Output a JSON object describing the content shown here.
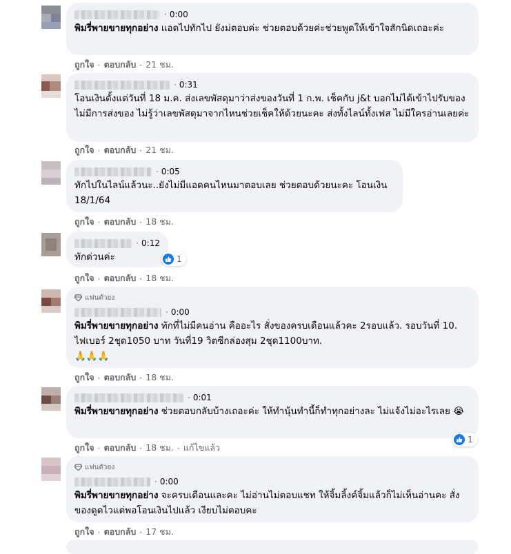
{
  "common": {
    "like": "ถูกใจ",
    "reply": "ตอบกลับ",
    "fan_badge": "แฟนตัวยง",
    "edited": "แก้ไขแล้ว",
    "separator": "·"
  },
  "colors": {
    "bubble_bg": "#f0f2f5",
    "meta_text": "#65676b",
    "like_blue": "#1877f2"
  },
  "comments": [
    {
      "time": "0:00",
      "tag": "พิมรี่พายขายทุกอย่าง",
      "text": "แอดไปทักไป ยังม่ตอบค่ะ ช่วยตอบด้วยค่ะช่วยพูดให้เข้าใจสักนิดเถอะค่ะ",
      "age": "21 ชม."
    },
    {
      "time": "0:31",
      "text": "โอนเงินตั้งแต่วันที่ 18 ม.ค. ส่งเลขพัสดุมาว่าส่งของวันที่ 1 ก.พ. เช็คกับ j&t บอกไม่ได้เข้าไปรับของ ไม่มีการส่งของ ไม่รู้ว่าเลขพัสดุมาจากไหนช่วยเช็คให้ด้วยนะคะ ส่งทั้งไลน์ทั้งเฟส ไม่มีใครอ่านเลยค่ะ",
      "age": "21 ชม."
    },
    {
      "time": "0:05",
      "text": "ทักไปในไลน์แล้วนะ..ยังไม่มีแอดคนไหนมาตอบเลย ช่วยตอบด้วยนะคะ โอนเงิน 18/1/64",
      "age": "18 ชม."
    },
    {
      "time": "0:12",
      "text": "ทักด่วนค่ะ",
      "age": "18 ชม.",
      "reactions": "1"
    },
    {
      "time": "0:00",
      "tag": "พิมรี่พายขายทุกอย่าง",
      "text": "ทักที่ไม่มีคนอ่าน คืออะไร สั่งของครบเดือนแล้วคะ 2รอบแล้ว. รอบวันที่ 10. ไฟเบอร์ 2ชุด1050 บาท วันที่19 วิตซีกล่องสุม 2ชุด1100บาท.",
      "emoji": "🙏🙏🙏",
      "age": "18 ชม."
    },
    {
      "time": "0:01",
      "tag": "พิมรี่พายขายทุกอย่าง",
      "text": "ช่วยตอบกลับบ้างเถอะค่ะ ให้ทำนุ้นทำนี้ก็ทำทุกอย่างละ ไม่แจ้งไม่อะไรเลย",
      "emoji": "😭",
      "age": "18 ชม.",
      "reactions": "1"
    },
    {
      "time": "0:00",
      "tag": "พิมรี่พายขายทุกอย่าง",
      "text": "จะครบเดือนและคะ ไม่อ่านไม่ตอบแชท ให้จิ้มลิ้งค์จิ้มแล้วก็ไม่เห็นอ่านคะ สั่งของดูดไวแต่พอโอนเงินไปแล้ว เงียบไม่ตอบคะ",
      "age": "17 ชม."
    }
  ]
}
